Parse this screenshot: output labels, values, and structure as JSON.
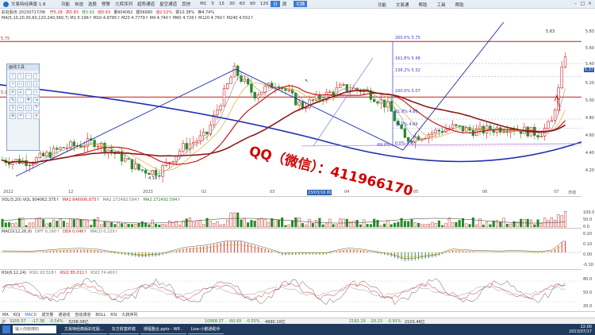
{
  "titlebar": {
    "app_title": "文易特经典版 1.8",
    "menu": [
      "功能",
      "自选",
      "选股",
      "预警",
      "九转序列",
      "趋势通道",
      "星空通道",
      "其他"
    ],
    "menu_active": "日线",
    "periods": [
      "M1",
      "5",
      "15",
      "30",
      "60",
      "90",
      "120",
      "日",
      "周"
    ],
    "extra_btn": "切换",
    "top_menu": [
      "功能",
      "文易通",
      "帮助",
      "工具",
      "帮助"
    ]
  },
  "infobar": {
    "text_prefix": "彩虹股份 20230717/06",
    "segments": [
      {
        "label": "开5.28",
        "cls": "up"
      },
      {
        "label": "高5.83",
        "cls": "up"
      },
      {
        "label": "低5.63",
        "cls": "dn"
      },
      {
        "label": "收5.63",
        "cls": "up"
      },
      {
        "label": "量904062",
        "cls": ""
      },
      {
        "label": "额56680",
        "cls": ""
      },
      {
        "label": "涨2.52%",
        "cls": "up"
      },
      {
        "label": "振10.38%",
        "cls": ""
      },
      {
        "label": "换4.74%",
        "cls": ""
      }
    ]
  },
  "mabar": "MA(5,10,20,30,60,120,240,360,7)   M1 5.196↑  M10 4.8785↑  M20 4.7779↑  M4 4.740↑  M60 4.726↑  M120 4.760↑  M240 4.552↑",
  "right_axis": [
    {
      "v": "5.83"
    },
    {
      "v": "5.60"
    },
    {
      "v": "5.40"
    },
    {
      "v": "5.37",
      "hl": true
    },
    {
      "v": "5.20"
    },
    {
      "v": "5.00"
    },
    {
      "v": "4.80"
    },
    {
      "v": "4.60"
    },
    {
      "v": "4.40"
    },
    {
      "v": "4.20"
    }
  ],
  "left_marks": {
    "top": "5.75",
    "mid": "5.1"
  },
  "peak_label": "5.83",
  "fib_labels": [
    {
      "t": "200.0% 5.75"
    },
    {
      "t": "161.8% 5.48"
    },
    {
      "t": "138.2% 5.32"
    },
    {
      "t": "100.0% 5.07"
    },
    {
      "t": "61.8% 4.80"
    },
    {
      "t": "38.2% 4.69"
    },
    {
      "t": "-69.0%"
    },
    {
      "t": "0.0% 4.47"
    }
  ],
  "low_label": "4.10",
  "date_axis": [
    {
      "t": "2022"
    },
    {
      "t": "12"
    },
    {
      "t": "2023"
    },
    {
      "t": "02"
    },
    {
      "t": "03"
    },
    {
      "t": "23/03/16 四",
      "sel": true
    },
    {
      "t": "04"
    },
    {
      "t": "05"
    },
    {
      "t": "06"
    },
    {
      "t": "07"
    }
  ],
  "date_axis_unit": "日线",
  "vol": {
    "hdr_name": "VOL(5,20)",
    "segments": [
      {
        "t": "VOL 904062.375↑",
        "cls": "c1"
      },
      {
        "t": "MA1 646006.875↑",
        "cls": "c2"
      },
      {
        "t": "MA2 272492.594↑",
        "cls": "c4"
      },
      {
        "t": "MA2 272492.594↑",
        "cls": "c3"
      }
    ],
    "axis": [
      "100.0",
      "50.0",
      "0.0"
    ]
  },
  "macd": {
    "segments": [
      {
        "t": "MACD(12,26,9)",
        "cls": "c1"
      },
      {
        "t": "DIFF 0.160↑",
        "cls": "c4"
      },
      {
        "t": "DEA 0.046↑",
        "cls": "c2"
      },
      {
        "t": "MACD 0.229↑",
        "cls": "c4"
      }
    ],
    "axis": [
      "0.20",
      "0.10",
      "0.00",
      "-0.10"
    ]
  },
  "rsi": {
    "segments": [
      {
        "t": "RSI(6,12,24)",
        "cls": "c1"
      },
      {
        "t": "RSI1 93.518↑",
        "cls": "c4"
      },
      {
        "t": "RSI2 85.011↑",
        "cls": "c2"
      },
      {
        "t": "RSI3 74.400↑",
        "cls": "c4"
      }
    ],
    "axis": [
      "80.0",
      "50.0",
      "20.0"
    ]
  },
  "tabs": [
    "MA",
    "KDJ",
    "MACD",
    "成交量",
    "通道线",
    "自动通道",
    "BOLL",
    "RSI",
    "九转序列"
  ],
  "tabs_active": "MACD",
  "statusbar": {
    "left_label": "沪",
    "left_index": "3205.57",
    "left_chg": "-17.38",
    "left_pct": "-0.54%",
    "left_amt": "3208.08亿",
    "mid_index": "10968.37",
    "mid_chg": "-60.93",
    "mid_pct": "-0.55%",
    "mid_amt": "4990.10亿",
    "r_index": "2192.19",
    "r_chg": "-20.23",
    "r_pct": "-0.91%",
    "r_amt": "2103.46亿"
  },
  "drawtool": {
    "title": "画线工具",
    "icons": [
      "/",
      "\\",
      "—",
      "|",
      "↗",
      "▭",
      "○",
      "△",
      "≡",
      "∠",
      "⌒",
      "∿",
      "%",
      "¦",
      "#",
      "⇲",
      "↕",
      "↔",
      "◇",
      "T",
      "⊕",
      "⌗",
      "⋯",
      "×"
    ]
  },
  "watermark": "QQ（微信）：411966170",
  "taskbar": {
    "search": "输入你想搜的",
    "items": [
      "",
      "文易特经典版彩虹股...",
      "东方财富终端",
      "课程整合.pptx - WP...",
      "Live-小鹅通助手"
    ],
    "time": "22:00",
    "date": "2023/07/17"
  },
  "colors": {
    "up": "#d12020",
    "down": "#2a8a2a",
    "blue": "#1f2fb0",
    "ma_red": "#c81818",
    "ma_brown": "#8b1a1a"
  }
}
